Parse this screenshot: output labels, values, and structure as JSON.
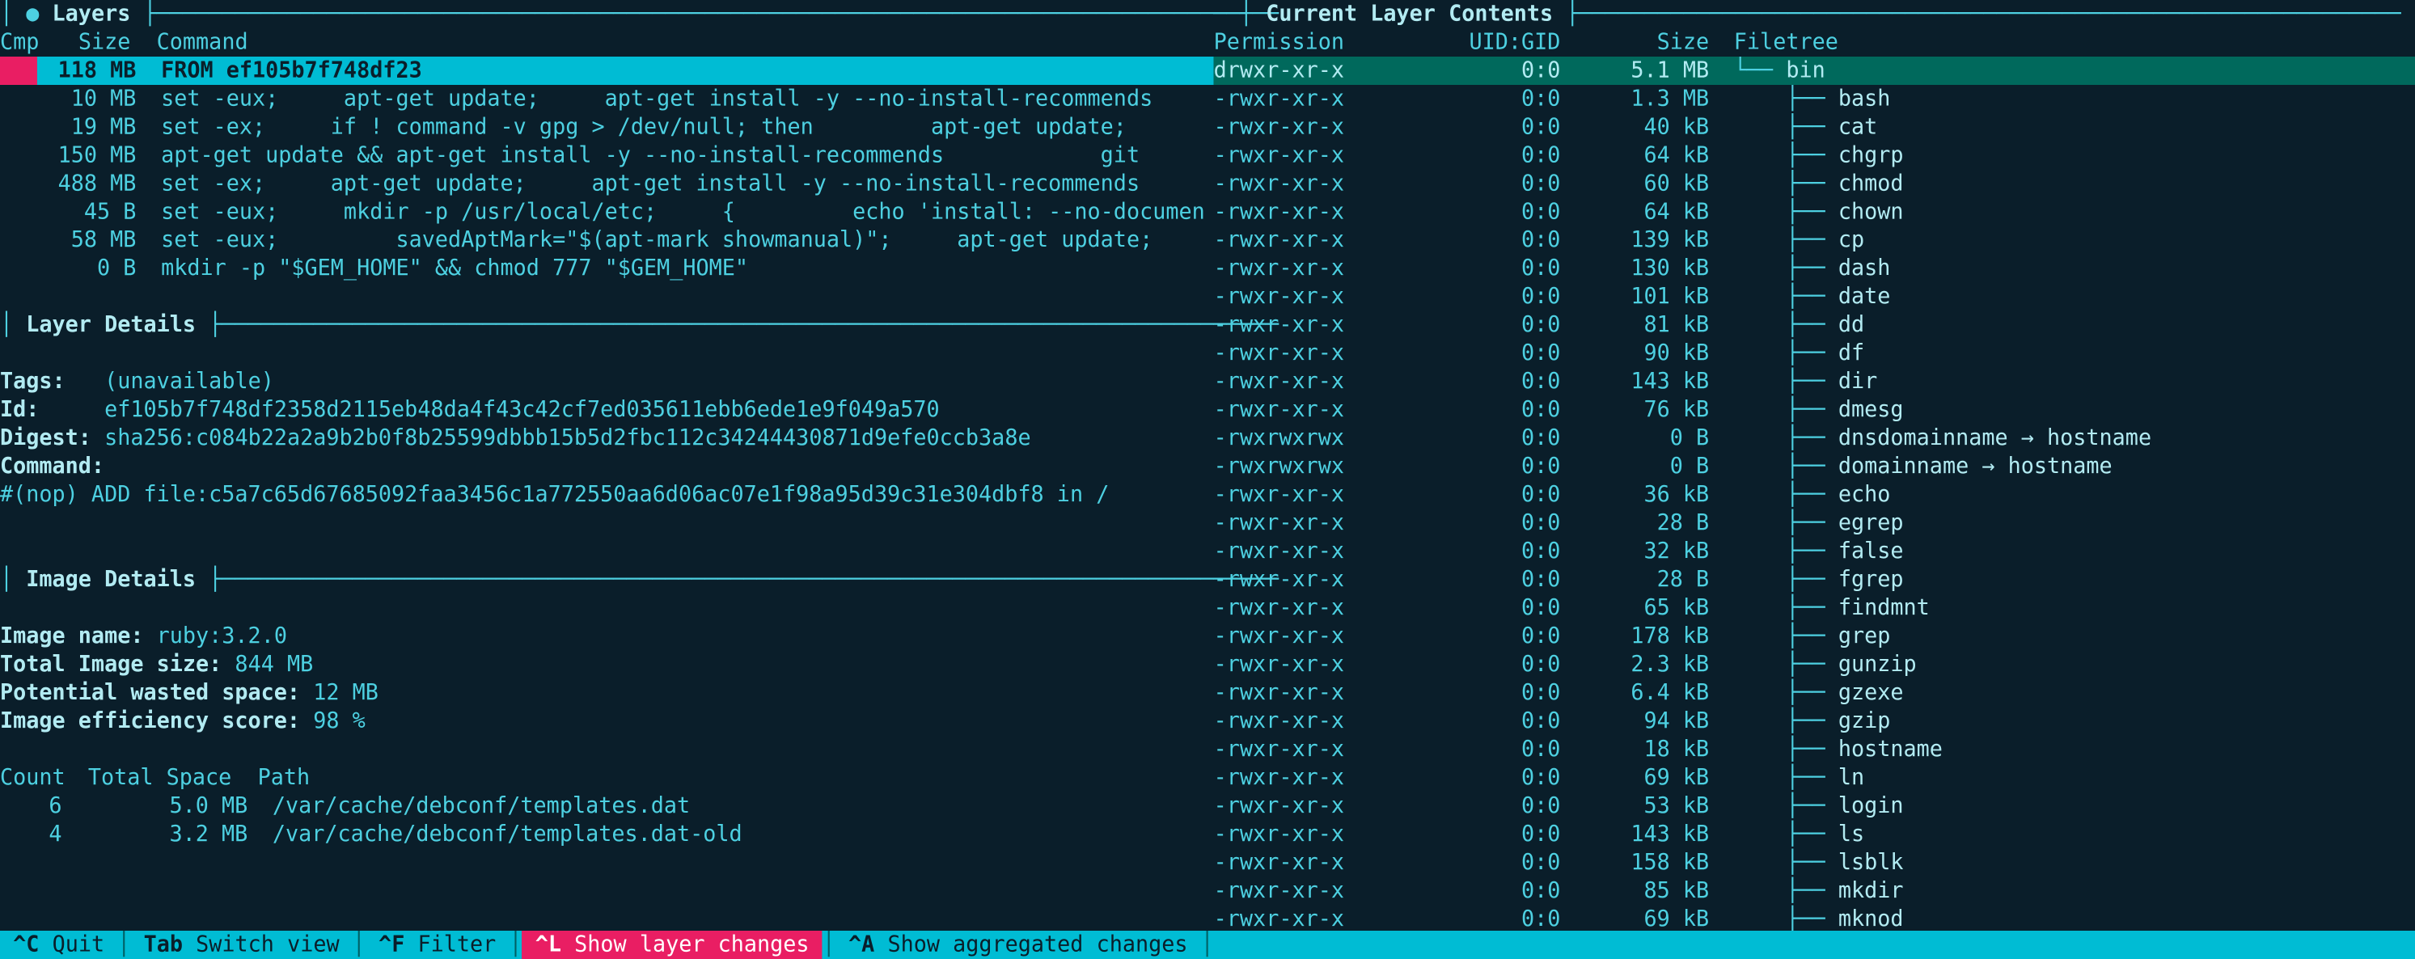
{
  "sections": {
    "layers_title": "Layers",
    "layer_details_title": "Layer Details",
    "image_details_title": "Image Details",
    "contents_title": "Current Layer Contents"
  },
  "layers": {
    "headers": {
      "cmp": "Cmp",
      "size": "Size",
      "command": "Command"
    },
    "rows": [
      {
        "size": "118 MB",
        "command": "FROM ef105b7f748df23",
        "selected": true
      },
      {
        "size": "10 MB",
        "command": "set -eux;     apt-get update;     apt-get install -y --no-install-recommends"
      },
      {
        "size": "19 MB",
        "command": "set -ex;     if ! command -v gpg > /dev/null; then         apt-get update;"
      },
      {
        "size": "150 MB",
        "command": "apt-get update && apt-get install -y --no-install-recommends            git"
      },
      {
        "size": "488 MB",
        "command": "set -ex;     apt-get update;     apt-get install -y --no-install-recommends"
      },
      {
        "size": "45 B",
        "command": "set -eux;     mkdir -p /usr/local/etc;     {         echo 'install: --no-documen"
      },
      {
        "size": "58 MB",
        "command": "set -eux;         savedAptMark=\"$(apt-mark showmanual)\";     apt-get update;"
      },
      {
        "size": "0 B",
        "command": "mkdir -p \"$GEM_HOME\" && chmod 777 \"$GEM_HOME\""
      }
    ]
  },
  "layer_details": {
    "tags_label": "Tags:",
    "tags_value": "(unavailable)",
    "id_label": "Id:",
    "id_value": "ef105b7f748df2358d2115eb48da4f43c42cf7ed035611ebb6ede1e9f049a570",
    "digest_label": "Digest:",
    "digest_value": "sha256:c084b22a2a9b2b0f8b25599dbbb15b5d2fbc112c34244430871d9efe0ccb3a8e",
    "command_label": "Command:",
    "command_value": "#(nop) ADD file:c5a7c65d67685092faa3456c1a772550aa6d06ac07e1f98a95d39c31e304dbf8 in /"
  },
  "image_details": {
    "name_label": "Image name:",
    "name_value": "ruby:3.2.0",
    "size_label": "Total Image size:",
    "size_value": "844 MB",
    "wasted_label": "Potential wasted space:",
    "wasted_value": "12 MB",
    "eff_label": "Image efficiency score:",
    "eff_value": "98 %",
    "wasted_headers": {
      "count": "Count",
      "space": "Total Space",
      "path": "Path"
    },
    "wasted_rows": [
      {
        "count": "6",
        "space": "5.0 MB",
        "path": "/var/cache/debconf/templates.dat"
      },
      {
        "count": "4",
        "space": "3.2 MB",
        "path": "/var/cache/debconf/templates.dat-old"
      }
    ]
  },
  "contents": {
    "headers": {
      "perm": "Permission",
      "uidgid": "UID:GID",
      "size": "Size",
      "tree": "Filetree"
    },
    "rows": [
      {
        "perm": "drwxr-xr-x",
        "uidgid": "0:0",
        "size": "5.1 MB",
        "branch": "└── ",
        "name": "bin",
        "selected": true
      },
      {
        "perm": "-rwxr-xr-x",
        "uidgid": "0:0",
        "size": "1.3 MB",
        "branch": "    ├── ",
        "name": "bash"
      },
      {
        "perm": "-rwxr-xr-x",
        "uidgid": "0:0",
        "size": "40 kB",
        "branch": "    ├── ",
        "name": "cat"
      },
      {
        "perm": "-rwxr-xr-x",
        "uidgid": "0:0",
        "size": "64 kB",
        "branch": "    ├── ",
        "name": "chgrp"
      },
      {
        "perm": "-rwxr-xr-x",
        "uidgid": "0:0",
        "size": "60 kB",
        "branch": "    ├── ",
        "name": "chmod"
      },
      {
        "perm": "-rwxr-xr-x",
        "uidgid": "0:0",
        "size": "64 kB",
        "branch": "    ├── ",
        "name": "chown"
      },
      {
        "perm": "-rwxr-xr-x",
        "uidgid": "0:0",
        "size": "139 kB",
        "branch": "    ├── ",
        "name": "cp"
      },
      {
        "perm": "-rwxr-xr-x",
        "uidgid": "0:0",
        "size": "130 kB",
        "branch": "    ├── ",
        "name": "dash"
      },
      {
        "perm": "-rwxr-xr-x",
        "uidgid": "0:0",
        "size": "101 kB",
        "branch": "    ├── ",
        "name": "date"
      },
      {
        "perm": "-rwxr-xr-x",
        "uidgid": "0:0",
        "size": "81 kB",
        "branch": "    ├── ",
        "name": "dd"
      },
      {
        "perm": "-rwxr-xr-x",
        "uidgid": "0:0",
        "size": "90 kB",
        "branch": "    ├── ",
        "name": "df"
      },
      {
        "perm": "-rwxr-xr-x",
        "uidgid": "0:0",
        "size": "143 kB",
        "branch": "    ├── ",
        "name": "dir"
      },
      {
        "perm": "-rwxr-xr-x",
        "uidgid": "0:0",
        "size": "76 kB",
        "branch": "    ├── ",
        "name": "dmesg"
      },
      {
        "perm": "-rwxrwxrwx",
        "uidgid": "0:0",
        "size": "0 B",
        "branch": "    ├── ",
        "name": "dnsdomainname → hostname"
      },
      {
        "perm": "-rwxrwxrwx",
        "uidgid": "0:0",
        "size": "0 B",
        "branch": "    ├── ",
        "name": "domainname → hostname"
      },
      {
        "perm": "-rwxr-xr-x",
        "uidgid": "0:0",
        "size": "36 kB",
        "branch": "    ├── ",
        "name": "echo"
      },
      {
        "perm": "-rwxr-xr-x",
        "uidgid": "0:0",
        "size": "28 B",
        "branch": "    ├── ",
        "name": "egrep"
      },
      {
        "perm": "-rwxr-xr-x",
        "uidgid": "0:0",
        "size": "32 kB",
        "branch": "    ├── ",
        "name": "false"
      },
      {
        "perm": "-rwxr-xr-x",
        "uidgid": "0:0",
        "size": "28 B",
        "branch": "    ├── ",
        "name": "fgrep"
      },
      {
        "perm": "-rwxr-xr-x",
        "uidgid": "0:0",
        "size": "65 kB",
        "branch": "    ├── ",
        "name": "findmnt"
      },
      {
        "perm": "-rwxr-xr-x",
        "uidgid": "0:0",
        "size": "178 kB",
        "branch": "    ├── ",
        "name": "grep"
      },
      {
        "perm": "-rwxr-xr-x",
        "uidgid": "0:0",
        "size": "2.3 kB",
        "branch": "    ├── ",
        "name": "gunzip"
      },
      {
        "perm": "-rwxr-xr-x",
        "uidgid": "0:0",
        "size": "6.4 kB",
        "branch": "    ├── ",
        "name": "gzexe"
      },
      {
        "perm": "-rwxr-xr-x",
        "uidgid": "0:0",
        "size": "94 kB",
        "branch": "    ├── ",
        "name": "gzip"
      },
      {
        "perm": "-rwxr-xr-x",
        "uidgid": "0:0",
        "size": "18 kB",
        "branch": "    ├── ",
        "name": "hostname"
      },
      {
        "perm": "-rwxr-xr-x",
        "uidgid": "0:0",
        "size": "69 kB",
        "branch": "    ├── ",
        "name": "ln"
      },
      {
        "perm": "-rwxr-xr-x",
        "uidgid": "0:0",
        "size": "53 kB",
        "branch": "    ├── ",
        "name": "login"
      },
      {
        "perm": "-rwxr-xr-x",
        "uidgid": "0:0",
        "size": "143 kB",
        "branch": "    ├── ",
        "name": "ls"
      },
      {
        "perm": "-rwxr-xr-x",
        "uidgid": "0:0",
        "size": "158 kB",
        "branch": "    ├── ",
        "name": "lsblk"
      },
      {
        "perm": "-rwxr-xr-x",
        "uidgid": "0:0",
        "size": "85 kB",
        "branch": "    ├── ",
        "name": "mkdir"
      },
      {
        "perm": "-rwxr-xr-x",
        "uidgid": "0:0",
        "size": "69 kB",
        "branch": "    ├── ",
        "name": "mknod"
      }
    ]
  },
  "footer": {
    "quit_key": "^C",
    "quit_label": "Quit",
    "tab_key": "Tab",
    "tab_label": "Switch view",
    "filter_key": "^F",
    "filter_label": "Filter",
    "layer_key": "^L",
    "layer_label": "Show layer changes",
    "agg_key": "^A",
    "agg_label": "Show aggregated changes"
  }
}
